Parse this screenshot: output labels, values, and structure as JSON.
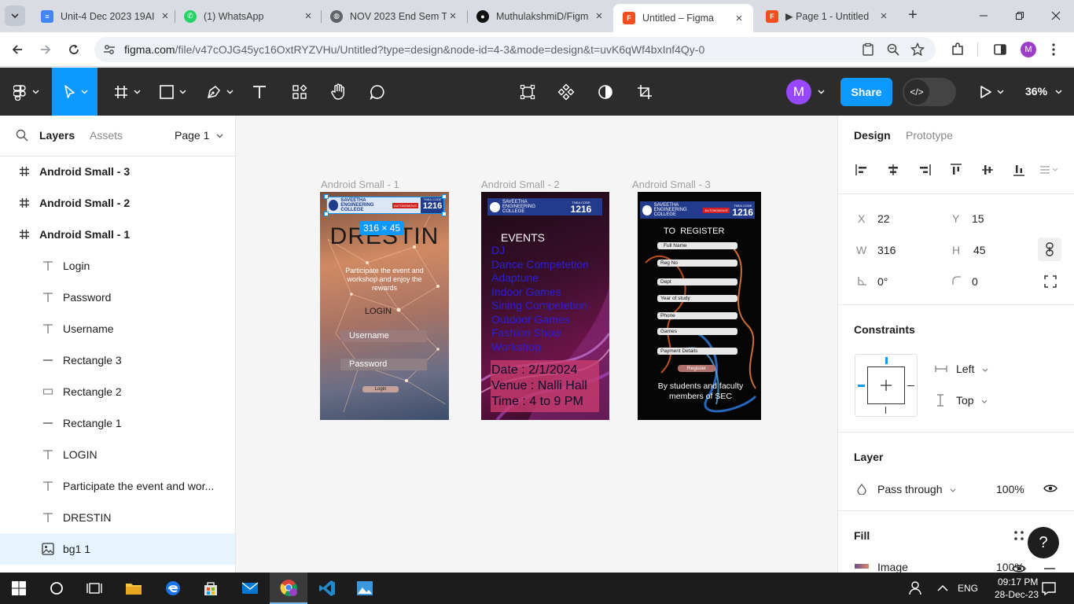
{
  "browser": {
    "tabs": [
      {
        "title": "Unit-4 Dec 2023 19AI",
        "favicon_color": "#4285f4",
        "favicon": "docs-icon",
        "active": false
      },
      {
        "title": "(1) WhatsApp",
        "favicon_color": "#25d366",
        "favicon": "whatsapp-icon",
        "active": false
      },
      {
        "title": "NOV 2023 End Sem T",
        "favicon_color": "#5f6368",
        "favicon": "globe-icon",
        "active": false
      },
      {
        "title": "MuthulakshmiD/Figm",
        "favicon_color": "#111111",
        "favicon": "github-icon",
        "active": false
      },
      {
        "title": "Untitled – Figma",
        "favicon_color": "#f24e1e",
        "favicon": "figma-icon",
        "active": true
      },
      {
        "title": "▶ Page 1 - Untitled",
        "favicon_color": "#f24e1e",
        "favicon": "figma-icon",
        "active": false
      }
    ],
    "url_host": "figma.com",
    "url_path": "/file/v47cOJG45yc16OxtRYZVHu/Untitled?type=design&node-id=4-3&mode=design&t=uvK6qWf4bxInf4Qy-0",
    "profile_initial": "M"
  },
  "toolbar": {
    "avatar_initial": "M",
    "share_label": "Share",
    "zoom": "36%",
    "devmode_glyph": "</>"
  },
  "layers_panel": {
    "tab_layers": "Layers",
    "tab_assets": "Assets",
    "page_selector": "Page 1",
    "items": [
      {
        "name": "Android Small - 3",
        "type": "frame"
      },
      {
        "name": "Android Small - 2",
        "type": "frame"
      },
      {
        "name": "Android Small - 1",
        "type": "frame"
      },
      {
        "name": "Login",
        "type": "text"
      },
      {
        "name": "Password",
        "type": "text"
      },
      {
        "name": "Username",
        "type": "text"
      },
      {
        "name": "Rectangle 3",
        "type": "line"
      },
      {
        "name": "Rectangle 2",
        "type": "rect"
      },
      {
        "name": "Rectangle 1",
        "type": "line"
      },
      {
        "name": "LOGIN",
        "type": "text"
      },
      {
        "name": "Participate the event and wor...",
        "type": "text"
      },
      {
        "name": "DRESTIN",
        "type": "text"
      },
      {
        "name": "bg1 1",
        "type": "image",
        "selected": true
      }
    ]
  },
  "canvas": {
    "frames": [
      {
        "label": "Android Small - 1"
      },
      {
        "label": "Android Small - 2"
      },
      {
        "label": "Android Small - 3"
      }
    ],
    "college_banner": {
      "name": "SAVEETHA ENGINEERING COLLEGE",
      "badge": "AUTONOMOUS",
      "code_label": "TNEA CODE",
      "code": "1216"
    },
    "selection_size": "316 × 45",
    "frame1": {
      "title": "DRESTIN",
      "tagline": "Participate the event and workshop and enjoy the rewards",
      "heading": "LOGIN",
      "username": "Username",
      "password": "Password",
      "button": "Login"
    },
    "frame2": {
      "heading": "EVENTS",
      "events": [
        "DJ",
        "Dance Competetion",
        "Adaptune",
        "Indoor Games",
        "Sining Competetion",
        "Outdoor Games",
        "Fashion Show",
        "Workshop"
      ],
      "date": "Date : 2/1/2024",
      "venue": "Venue : Nalli Hall",
      "time": "Time : 4 to 9 PM"
    },
    "frame3": {
      "heading": "TO  REGISTER",
      "fields": [
        "Full Name",
        "Reg No",
        "Dept",
        "Year of study",
        "Phone",
        "Games",
        "Payment Details"
      ],
      "button": "Register",
      "footer": "By students and faculty members of SEC"
    }
  },
  "props_panel": {
    "tab_design": "Design",
    "tab_prototype": "Prototype",
    "x_label": "X",
    "x_value": "22",
    "y_label": "Y",
    "y_value": "15",
    "w_label": "W",
    "w_value": "316",
    "h_label": "H",
    "h_value": "45",
    "rotation": "0°",
    "radius": "0",
    "constraints_title": "Constraints",
    "constraint_h": "Left",
    "constraint_v": "Top",
    "layer_title": "Layer",
    "blend_mode": "Pass through",
    "opacity": "100%",
    "fill_title": "Fill",
    "fill_type": "Image",
    "fill_opacity": "100%",
    "help": "?"
  },
  "taskbar": {
    "time": "09:17 PM",
    "date": "28-Dec-23",
    "lang": "ENG"
  }
}
